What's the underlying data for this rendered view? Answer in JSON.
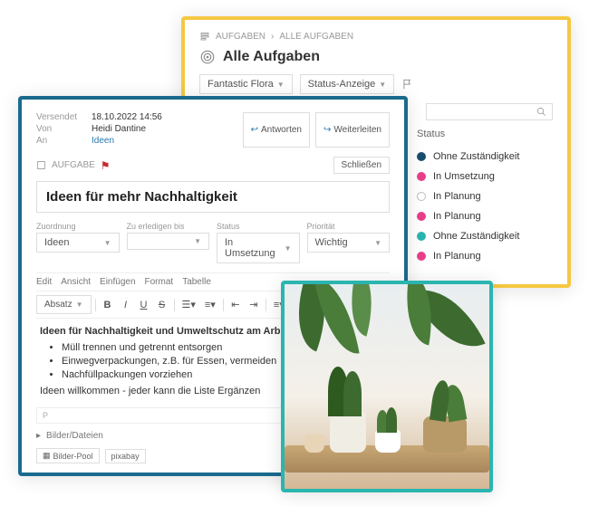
{
  "tasks_panel": {
    "breadcrumb1": "AUFGABEN",
    "breadcrumb2": "ALLE AUFGABEN",
    "title": "Alle Aufgaben",
    "filter1": "Fantastic Flora",
    "filter2": "Status-Anzeige",
    "status_header": "Status",
    "statuses": [
      {
        "color": "#1a4e6e",
        "label": "Ohne Zuständigkeit"
      },
      {
        "color": "#e83e8c",
        "label": "In Umsetzung"
      },
      {
        "color": "#ffffff",
        "border": "#bbb",
        "label": "In Planung"
      },
      {
        "color": "#e83e8c",
        "label": "In Planung"
      },
      {
        "color": "#2bb5b0",
        "label": "Ohne Zuständigkeit"
      },
      {
        "color": "#e83e8c",
        "label": "In Planung"
      }
    ]
  },
  "task_panel": {
    "sent_label": "Versendet",
    "sent_val": "18.10.2022 14:56",
    "from_label": "Von",
    "from_val": "Heidi Dantine",
    "to_label": "An",
    "to_val": "Ideen",
    "reply": "Antworten",
    "forward": "Weiterleiten",
    "task_tag": "AUFGABE",
    "close": "Schließen",
    "title": "Ideen für mehr Nachhaltigkeit",
    "fields": {
      "zuordnung_label": "Zuordnung",
      "zuordnung": "Ideen",
      "erledigen_label": "Zu erledigen bis",
      "erledigen": "",
      "status_label": "Status",
      "status": "In Umsetzung",
      "prio_label": "Priorität",
      "prio": "Wichtig"
    },
    "menu": [
      "Edit",
      "Ansicht",
      "Einfügen",
      "Format",
      "Tabelle"
    ],
    "format_dd": "Absatz",
    "content_heading": "Ideen für Nachhaltigkeit und Umweltschutz am Arbeitsplatz:",
    "bullets": [
      "Müll trennen und getrennt entsorgen",
      "Einwegverpackungen, z.B. für Essen, vermeiden",
      "Nachfüllpackungen vorziehen"
    ],
    "content_footer": "Ideen willkommen - jeder kann die Liste Ergänzen",
    "path": "P",
    "attach_label": "Bilder/Dateien",
    "chip1": "Bilder-Pool",
    "chip2": "pixabay"
  }
}
